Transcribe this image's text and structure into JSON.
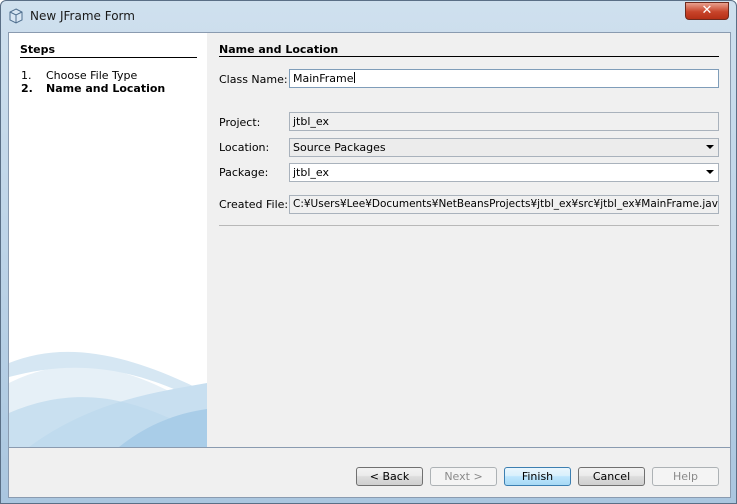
{
  "window": {
    "title": "New JFrame Form",
    "close_glyph": "✕"
  },
  "steps": {
    "heading": "Steps",
    "items": [
      {
        "num": "1.",
        "label": "Choose File Type",
        "active": false
      },
      {
        "num": "2.",
        "label": "Name and Location",
        "active": true
      }
    ]
  },
  "form": {
    "heading": "Name and Location",
    "class_name": {
      "label": "Class Name:",
      "value": "MainFrame"
    },
    "project": {
      "label": "Project:",
      "value": "jtbl_ex"
    },
    "location": {
      "label": "Location:",
      "value": "Source Packages"
    },
    "package": {
      "label": "Package:",
      "value": "jtbl_ex"
    },
    "created_file": {
      "label": "Created File:",
      "value": "C:¥Users¥Lee¥Documents¥NetBeansProjects¥jtbl_ex¥src¥jtbl_ex¥MainFrame.java"
    }
  },
  "buttons": {
    "back": "< Back",
    "next": "Next >",
    "finish": "Finish",
    "cancel": "Cancel",
    "help": "Help"
  },
  "colors": {
    "accent": "#3c7fb1",
    "close": "#c8442a"
  }
}
